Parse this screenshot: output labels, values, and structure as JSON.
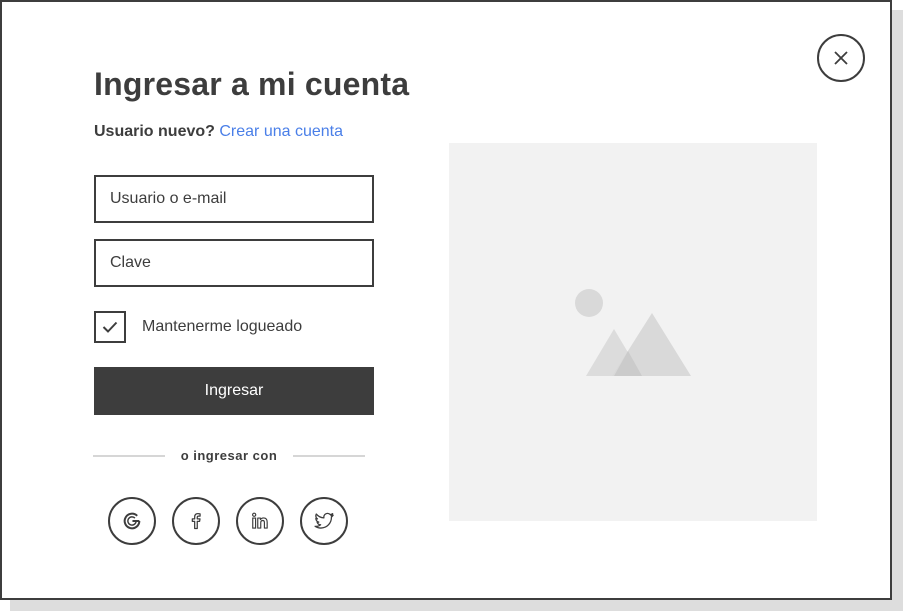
{
  "modal": {
    "title": "Ingresar a mi cuenta",
    "new_user_label": "Usuario nuevo?",
    "create_account_link": "Crear una cuenta",
    "username_placeholder": "Usuario o e-mail",
    "password_placeholder": "Clave",
    "remember_label": "Mantenerme logueado",
    "remember_checked": true,
    "submit_label": "Ingresar",
    "divider_text": "o ingresar con",
    "social": [
      {
        "icon": "google-icon"
      },
      {
        "icon": "facebook-icon"
      },
      {
        "icon": "linkedin-icon"
      },
      {
        "icon": "twitter-icon"
      }
    ],
    "close_icon": "close-icon",
    "image_icon": "image-placeholder-icon"
  },
  "colors": {
    "text": "#3d3d3d",
    "link": "#4a7fe8",
    "button_bg": "#3d3d3d",
    "button_text": "#ffffff",
    "placeholder_bg": "#f2f2f2"
  }
}
